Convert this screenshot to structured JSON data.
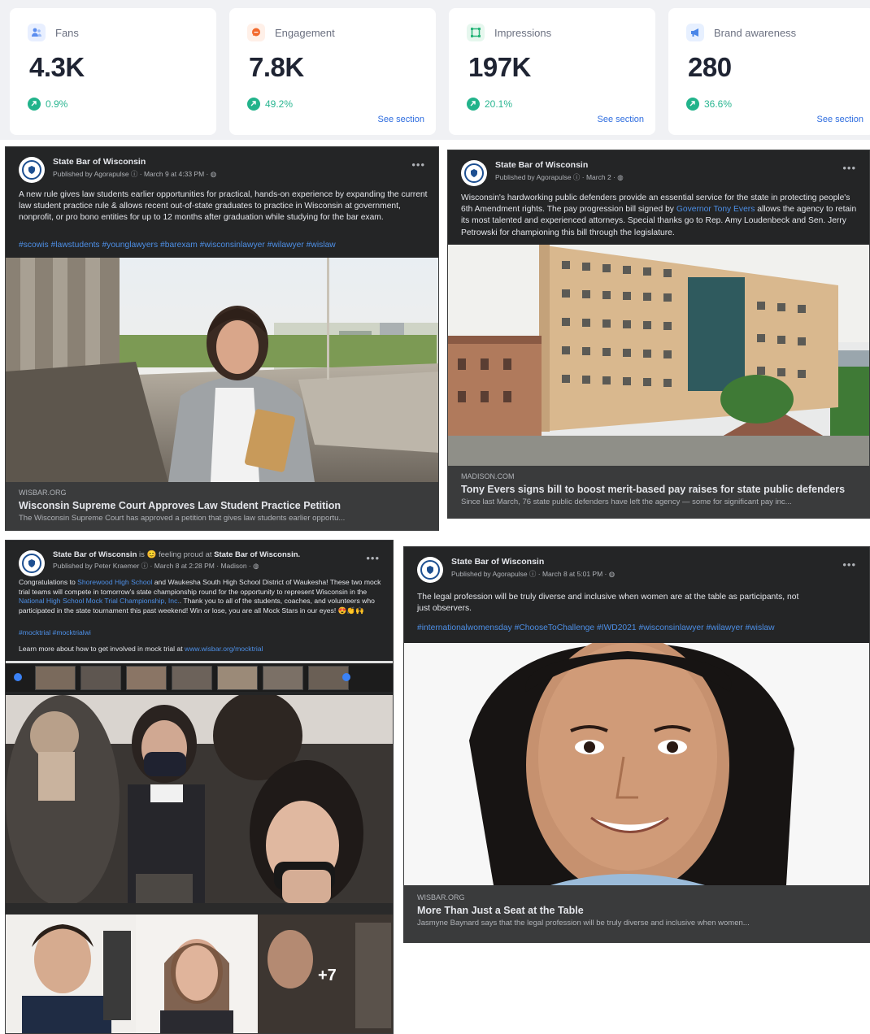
{
  "metrics": [
    {
      "label": "Fans",
      "value": "4.3K",
      "change": "0.9%",
      "link": "",
      "icon": "users-icon",
      "icon_color": "#5b8def",
      "icon_bg": "#e8efff"
    },
    {
      "label": "Engagement",
      "value": "7.8K",
      "change": "49.2%",
      "link": "See section",
      "icon": "chat-bubble-icon",
      "icon_color": "#f2692c",
      "icon_bg": "#fff0e8"
    },
    {
      "label": "Impressions",
      "value": "197K",
      "change": "20.1%",
      "link": "See section",
      "icon": "frame-icon",
      "icon_color": "#28b57a",
      "icon_bg": "#e6f7ee"
    },
    {
      "label": "Brand awareness",
      "value": "280",
      "change": "36.6%",
      "link": "See section",
      "icon": "megaphone-icon",
      "icon_color": "#4a86e8",
      "icon_bg": "#e7f0ff"
    }
  ],
  "posts": [
    {
      "page": "State Bar of Wisconsin",
      "meta": "Published by Agorapulse ⓘ · March 9 at 4:33 PM · ◍",
      "body": "A new rule gives law students earlier opportunities for practical, hands-on experience by expanding the current law student practice rule & allows recent out-of-state graduates to practice in Wisconsin at government, nonprofit, or pro bono entities for up to 12 months after graduation while studying for the bar exam.",
      "hashtags": "#scowis #lawstudents #younglawyers #barexam #wisconsinlawyer #wilawyer #wislaw",
      "preview": {
        "source": "WISBAR.ORG",
        "title": "Wisconsin Supreme Court Approves Law Student Practice Petition",
        "desc": "The Wisconsin Supreme Court has approved a petition that gives law students earlier opportu..."
      }
    },
    {
      "page": "State Bar of Wisconsin",
      "meta": "Published by Agorapulse ⓘ · March 2 · ◍",
      "body_1": "Wisconsin's hardworking public defenders provide an essential service for the state in protecting people's 6th Amendment rights. The pay progression bill signed by",
      "body_link": "Governor Tony Evers",
      "body_2": "allows the agency to retain its most talented and experienced attorneys. Special thanks go to Rep. Amy Loudenbeck and Sen. Jerry Petrowski for championing this bill through the legislature.",
      "preview": {
        "source": "MADISON.COM",
        "title": "Tony Evers signs bill to boost merit-based pay raises for state public defenders",
        "desc": "Since last March, 76 state public defenders have left the agency — some for significant pay inc..."
      }
    },
    {
      "page": "State Bar of Wisconsin",
      "status": "is 😊 feeling proud at",
      "status_page": "State Bar of Wisconsin.",
      "meta": "Published by Peter Kraemer ⓘ · March 8 at 2:28 PM · Madison · ◍",
      "body_a": "Congratulations to",
      "body_link1": "Shorewood High School",
      "body_b": "and Waukesha South High School District of Waukesha! These two mock trial teams will compete in tomorrow's state championship round for the opportunity to represent Wisconsin in the",
      "body_link2": "National High School Mock Trial Championship, Inc.",
      "body_c": ". Thank you to all of the students, coaches, and volunteers who participated in the state tournament this past weekend! Win or lose, you are all Mock Stars in our eyes! 😍👏🙌",
      "hashtags": "#mocktrial #mocktrialwi",
      "learn_text": "Learn more about how to get involved in mock trial at",
      "learn_link": "www.wisbar.org/mocktrial",
      "more_count": "+7"
    },
    {
      "page": "State Bar of Wisconsin",
      "meta": "Published by Agorapulse ⓘ · March 8 at 5:01 PM · ◍",
      "body": "The legal profession will be truly diverse and inclusive when women are at the table as participants, not just observers.",
      "hashtags": "#internationalwomensday #ChooseToChallenge #IWD2021 #wisconsinlawyer #wilawyer #wislaw",
      "preview": {
        "source": "WISBAR.ORG",
        "title": "More Than Just a Seat at the Table",
        "desc": "Jasmyne Baynard says that the legal profession will be truly diverse and inclusive when women..."
      }
    }
  ]
}
